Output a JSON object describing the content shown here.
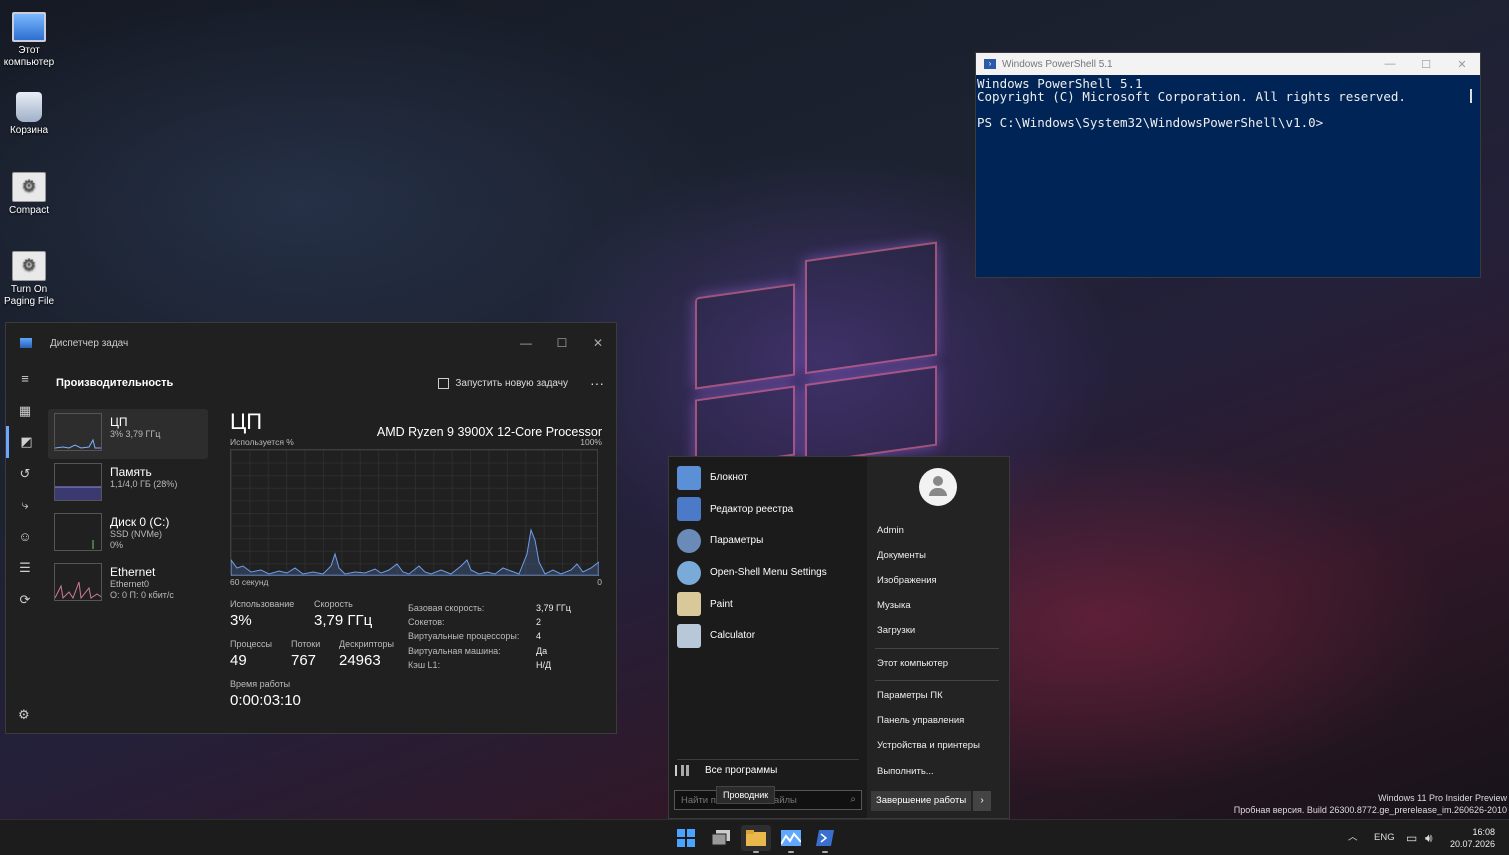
{
  "desktop": {
    "icons": [
      {
        "label": "Этот компьютер"
      },
      {
        "label": "Корзина"
      },
      {
        "label": "Compact"
      },
      {
        "label": "Turn On Paging File"
      }
    ],
    "watermark_line1": "Windows 11 Pro Insider Preview",
    "watermark_line2": "Пробная версия. Build 26300.8772.ge_prerelease_im.260626-2010"
  },
  "powershell": {
    "title": "Windows PowerShell 5.1",
    "lines": [
      "Windows PowerShell 5.1",
      "Copyright (C) Microsoft Corporation. All rights reserved.",
      "",
      "PS C:\\Windows\\System32\\WindowsPowerShell\\v1.0>"
    ]
  },
  "taskmanager": {
    "title": "Диспетчер задач",
    "header": "Производительность",
    "run_task": "Запустить новую задачу",
    "devices": [
      {
        "name": "ЦП",
        "line1": "3% 3,79 ГГц",
        "line2": ""
      },
      {
        "name": "Память",
        "line1": "1,1/4,0 ГБ (28%)",
        "line2": ""
      },
      {
        "name": "Диск 0 (C:)",
        "line1": "SSD (NVMe)",
        "line2": "0%"
      },
      {
        "name": "Ethernet",
        "line1": "Ethernet0",
        "line2": "О: 0 П: 0 кбит/с"
      }
    ],
    "cpu": {
      "title": "ЦП",
      "processor": "AMD Ryzen 9 3900X 12-Core Processor",
      "usage_label": "Используется %",
      "max_label": "100%",
      "time_label": "60 секунд",
      "min_label": "0",
      "stats": {
        "usage_label": "Использование",
        "usage": "3%",
        "speed_label": "Скорость",
        "speed": "3,79 ГГц",
        "processes_label": "Процессы",
        "processes": "49",
        "threads_label": "Потоки",
        "threads": "767",
        "handles_label": "Дескрипторы",
        "handles": "24963",
        "uptime_label": "Время работы",
        "uptime": "0:00:03:10"
      },
      "details": [
        {
          "k": "Базовая скорость:",
          "v": "3,79 ГГц"
        },
        {
          "k": "Сокетов:",
          "v": "2"
        },
        {
          "k": "Виртуальные процессоры:",
          "v": "4"
        },
        {
          "k": "Виртуальная машина:",
          "v": "Да"
        },
        {
          "k": "Кэш L1:",
          "v": "Н/Д"
        }
      ]
    }
  },
  "startmenu": {
    "apps": [
      {
        "label": "Блокнот",
        "icon": "notepad-icon",
        "color": "#5b8fd6"
      },
      {
        "label": "Редактор реестра",
        "icon": "regedit-icon",
        "color": "#4a7ac8"
      },
      {
        "label": "Параметры",
        "icon": "settings-icon",
        "color": "#6a8ab8"
      },
      {
        "label": "Open-Shell Menu Settings",
        "icon": "openshell-icon",
        "color": "#7aaad8"
      },
      {
        "label": "Paint",
        "icon": "paint-icon",
        "color": "#d8c89a"
      },
      {
        "label": "Calculator",
        "icon": "calculator-icon",
        "color": "#b8c8d8"
      }
    ],
    "all_programs": "Все программы",
    "search_placeholder": "Найти п",
    "search_placeholder_rest": "айлы",
    "tooltip": "Проводник",
    "user": "Admin",
    "right_items_a": [
      "Документы",
      "Изображения",
      "Музыка",
      "Загрузки"
    ],
    "right_item_pc": "Этот компьютер",
    "right_items_b": [
      "Параметры ПК",
      "Панель управления",
      "Устройства и принтеры",
      "Выполнить..."
    ],
    "shutdown": "Завершение работы"
  },
  "taskbar": {
    "lang": "ENG",
    "time": "16:08",
    "date": "20.07.2026"
  }
}
